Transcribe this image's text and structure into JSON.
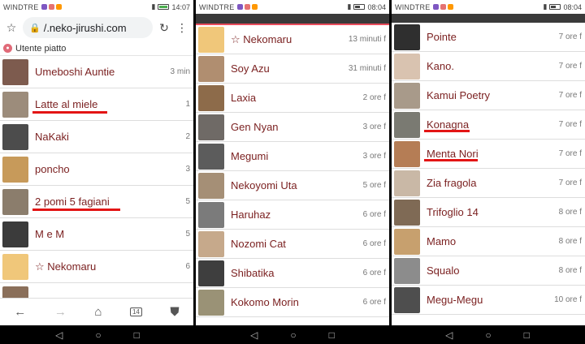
{
  "status_bar": [
    {
      "carrier": "WINDTRE",
      "time": "14:07"
    },
    {
      "carrier": "WINDTRE",
      "time": "08:04"
    },
    {
      "carrier": "WINDTRE",
      "time": "08:04"
    }
  ],
  "browser": {
    "url": "/.neko-jirushi.com",
    "breadcrumb": "Utente piatto"
  },
  "panel1": [
    {
      "name": "Umeboshi Auntie",
      "time": "3 min",
      "color": "#7d5b4e"
    },
    {
      "name": "Latte al miele",
      "time": "1",
      "color": "#9c8c7b",
      "underlined": true
    },
    {
      "name": "NaKaki",
      "time": "2",
      "color": "#4c4c4c"
    },
    {
      "name": "poncho",
      "time": "3",
      "color": "#c79a5a"
    },
    {
      "name": "2 pomi 5 fagiani",
      "time": "5",
      "color": "#8b7d6c",
      "underlined": true
    },
    {
      "name": "M e M",
      "time": "5",
      "color": "#3b3b3b"
    },
    {
      "name": "☆ Nekomaru",
      "time": "6",
      "color": "#f0c77a"
    },
    {
      "name": "",
      "time": "",
      "color": "#8a6f5a"
    }
  ],
  "panel2": [
    {
      "name": "☆ Nekomaru",
      "time": "13 minuti f",
      "color": "#f0c77a"
    },
    {
      "name": "Soy Azu",
      "time": "31 minuti f",
      "color": "#b08e70"
    },
    {
      "name": "Laxia",
      "time": "2 ore f",
      "color": "#8d6b4a"
    },
    {
      "name": "Gen Nyan",
      "time": "3 ore f",
      "color": "#6f6a66"
    },
    {
      "name": "Megumi",
      "time": "3 ore f",
      "color": "#5c5c5c"
    },
    {
      "name": "Nekoyomi Uta",
      "time": "5 ore f",
      "color": "#a58f76"
    },
    {
      "name": "Haruhaz",
      "time": "6 ore f",
      "color": "#7b7b7b"
    },
    {
      "name": "Nozomi Cat",
      "time": "6 ore f",
      "color": "#c6a98b"
    },
    {
      "name": "Shibatika",
      "time": "6 ore f",
      "color": "#3e3e3e"
    },
    {
      "name": "Kokomo Morin",
      "time": "6 ore f",
      "color": "#9a9276"
    }
  ],
  "panel3": [
    {
      "name": "Pointe",
      "time": "7 ore f",
      "color": "#2f2f2f"
    },
    {
      "name": "Kano.",
      "time": "7 ore f",
      "color": "#d9c3b0"
    },
    {
      "name": "Kamui Poetry",
      "time": "7 ore f",
      "color": "#a89a8a"
    },
    {
      "name": "Konagna",
      "time": "7 ore f",
      "color": "#7a7a72",
      "underlined": true
    },
    {
      "name": "Menta Nori",
      "time": "7 ore f",
      "color": "#b57d55",
      "underlined": true
    },
    {
      "name": "Zia fragola",
      "time": "7 ore f",
      "color": "#c9b8a6"
    },
    {
      "name": "Trifoglio 14",
      "time": "8 ore f",
      "color": "#7f6a55"
    },
    {
      "name": "Mamo",
      "time": "8 ore f",
      "color": "#c7a06e"
    },
    {
      "name": "Squalo",
      "time": "8 ore f",
      "color": "#8c8c8c"
    },
    {
      "name": "Megu-Megu",
      "time": "10 ore f",
      "color": "#4e4e4e"
    }
  ],
  "colors": {
    "name_text": "#7a1f1f",
    "accent_line": "#e94c5b",
    "underline": "#e31515"
  }
}
